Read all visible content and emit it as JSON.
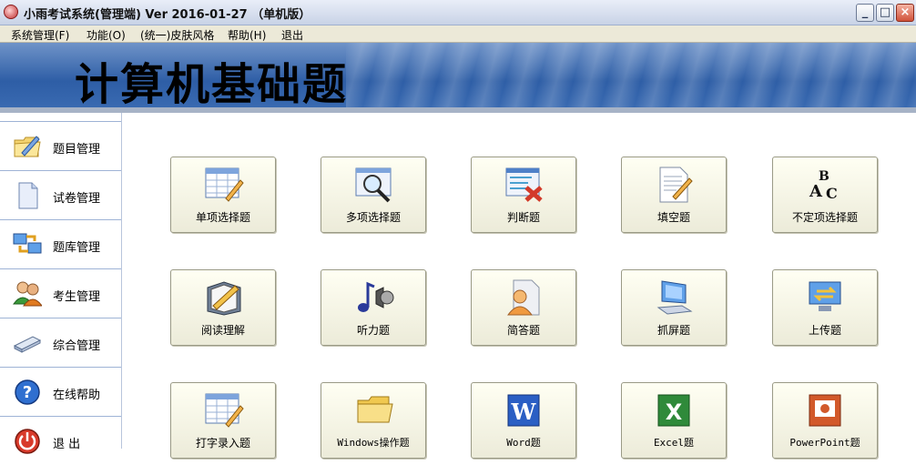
{
  "window": {
    "title": "小雨考试系统(管理端) Ver 2016-01-27  （单机版）",
    "minimize_glyph": "_",
    "maximize_glyph": "□",
    "close_glyph": "×"
  },
  "menu": [
    {
      "label": "系统管理(F)"
    },
    {
      "label": "功能(O)"
    },
    {
      "label": "(统一)皮肤风格"
    },
    {
      "label": "帮助(H)"
    },
    {
      "label": "退出"
    }
  ],
  "banner": {
    "title": "计算机基础题"
  },
  "sidebar": [
    {
      "label": "题目管理",
      "icon": "folder-pencil-icon"
    },
    {
      "label": "试卷管理",
      "icon": "document-icon"
    },
    {
      "label": "题库管理",
      "icon": "network-computers-icon"
    },
    {
      "label": "考生管理",
      "icon": "users-icon"
    },
    {
      "label": "综合管理",
      "icon": "scanner-icon"
    },
    {
      "label": "在线帮助",
      "icon": "help-icon"
    },
    {
      "label": "退  出",
      "icon": "power-icon"
    }
  ],
  "tiles": [
    {
      "label": "单项选择题",
      "icon": "grid-pencil-icon"
    },
    {
      "label": "多项选择题",
      "icon": "magnifier-window-icon"
    },
    {
      "label": "判断题",
      "icon": "window-cross-icon"
    },
    {
      "label": "填空题",
      "icon": "document-pencil-icon"
    },
    {
      "label": "不定项选择题",
      "icon": "abc-letters-icon"
    },
    {
      "label": "阅读理解",
      "icon": "book-pencil-icon"
    },
    {
      "label": "听力题",
      "icon": "music-speaker-icon"
    },
    {
      "label": "简答题",
      "icon": "person-document-icon"
    },
    {
      "label": "抓屏题",
      "icon": "monitor-keyboard-icon"
    },
    {
      "label": "上传题",
      "icon": "monitor-transfer-icon"
    },
    {
      "label": "打字录入题",
      "icon": "grid-pencil-icon"
    },
    {
      "label": "Windows操作题",
      "icon": "folder-icon"
    },
    {
      "label": "Word题",
      "icon": "word-icon"
    },
    {
      "label": "Excel题",
      "icon": "excel-icon"
    },
    {
      "label": "PowerPoint题",
      "icon": "powerpoint-icon"
    }
  ]
}
